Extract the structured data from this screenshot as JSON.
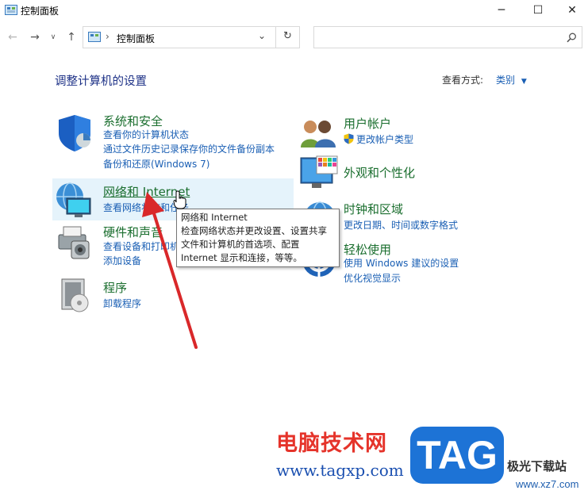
{
  "window": {
    "title": "控制面板"
  },
  "address": {
    "crumb": "控制面板",
    "separator": "›"
  },
  "search": {
    "placeholder": ""
  },
  "main": {
    "heading": "调整计算机的设置",
    "view_by_label": "查看方式:",
    "view_by_value": "类别"
  },
  "categories": {
    "security": {
      "title": "系统和安全",
      "links": [
        "查看你的计算机状态",
        "通过文件历史记录保存你的文件备份副本",
        "备份和还原(Windows 7)"
      ]
    },
    "network": {
      "title": "网络和 Internet",
      "links": [
        "查看网络状态和任务"
      ]
    },
    "hardware": {
      "title": "硬件和声音",
      "links": [
        "查看设备和打印机",
        "添加设备"
      ]
    },
    "programs": {
      "title": "程序",
      "links": [
        "卸载程序"
      ]
    },
    "users": {
      "title": "用户帐户",
      "links": [
        "更改帐户类型"
      ]
    },
    "appearance": {
      "title": "外观和个性化",
      "links": []
    },
    "clock": {
      "title": "时钟和区域",
      "links": [
        "更改日期、时间或数字格式"
      ]
    },
    "ease": {
      "title": "轻松使用",
      "links": [
        "使用 Windows 建议的设置",
        "优化视觉显示"
      ]
    }
  },
  "tooltip": {
    "lines": [
      "网络和 Internet",
      "检查网络状态并更改设置、设置共享",
      "文件和计算机的首选项、配置",
      "Internet 显示和连接，等等。"
    ]
  },
  "watermark": {
    "cn": "电脑技术网",
    "url": "www.tagxp.com",
    "tag": "TAG",
    "site": "极光下载站",
    "url2": "www.xz7.com"
  },
  "colors": {
    "title_green": "#1a6e2e",
    "link_blue": "#1a5fb4",
    "heading_blue": "#1e3287",
    "annotation_arrow": "#d9282a"
  }
}
